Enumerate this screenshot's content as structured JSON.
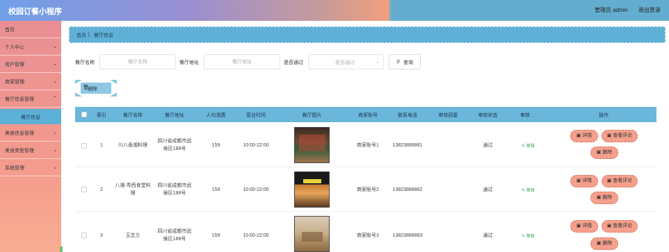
{
  "header": {
    "title": "校园订餐小程序",
    "admin": "管理员 admin",
    "logout": "退出登录"
  },
  "sidebar": {
    "items": [
      {
        "label": "首页",
        "chevron": false
      },
      {
        "label": "个人中心",
        "chevron": true
      },
      {
        "label": "用户管理",
        "chevron": true
      },
      {
        "label": "商家管理",
        "chevron": true
      },
      {
        "label": "餐厅信息管理",
        "chevron": true
      },
      {
        "label": "美食信息管理",
        "chevron": true
      },
      {
        "label": "美食类型管理",
        "chevron": true
      },
      {
        "label": "系统管理",
        "chevron": true
      }
    ],
    "active_sub": "餐厅信息"
  },
  "breadcrumb": {
    "home": "首页",
    "current": "餐厅信息"
  },
  "search": {
    "name_label": "餐厅名称",
    "name_placeholder": "餐厅名称",
    "addr_label": "餐厅地址",
    "addr_placeholder": "餐厅地址",
    "audit_label": "是否通过",
    "audit_placeholder": "是否通过",
    "query_button": "查询"
  },
  "actions": {
    "delete_label": "删除"
  },
  "table": {
    "headers": [
      "索引",
      "餐厅名称",
      "餐厅地址",
      "人均消费",
      "营业时间",
      "餐厅图片",
      "商家账号",
      "联系电话",
      "审核回复",
      "审核状态",
      "审核",
      "操作"
    ],
    "rows": [
      {
        "index": "1",
        "name": "川八香湘料理",
        "address": "四川省成都市武侯区188号",
        "avg": "159",
        "hours": "10:00-22:00",
        "account": "商家账号1",
        "phone": "13823888881",
        "reply": "",
        "status": "通过",
        "audit": "审核"
      },
      {
        "index": "2",
        "name": "八湘·粤西食堂料理",
        "address": "四川省成都市武侯区188号",
        "avg": "159",
        "hours": "10:00-22:00",
        "account": "商家账号2",
        "phone": "13823888882",
        "reply": "",
        "status": "通过",
        "audit": "审核"
      },
      {
        "index": "3",
        "name": "玉芝兰",
        "address": "四川省成都市武侯区188号",
        "avg": "159",
        "hours": "10:00-22:00",
        "account": "商家账号3",
        "phone": "13823888883",
        "reply": "",
        "status": "通过",
        "audit": "审核"
      }
    ],
    "op_detail": "详情",
    "op_review": "查看评论",
    "op_delete": "删除"
  },
  "colors": {
    "header_right": "#63aed0",
    "table_head": "#6ab7db",
    "pill": "#f5a08c",
    "sidebar": "#f39a8d"
  }
}
